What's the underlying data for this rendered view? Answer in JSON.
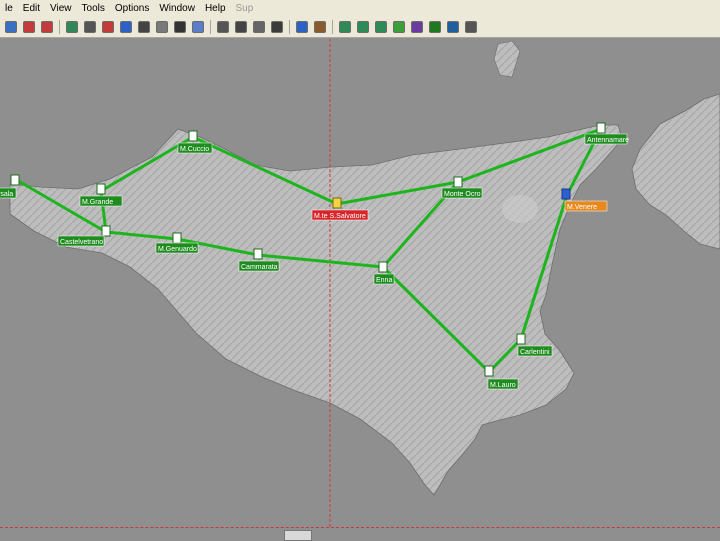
{
  "menu": {
    "items": [
      {
        "label": "le",
        "disabled": false
      },
      {
        "label": "Edit",
        "disabled": false
      },
      {
        "label": "View",
        "disabled": false
      },
      {
        "label": "Tools",
        "disabled": false
      },
      {
        "label": "Options",
        "disabled": false
      },
      {
        "label": "Window",
        "disabled": false
      },
      {
        "label": "Help",
        "disabled": false
      },
      {
        "label": "Sup",
        "disabled": true
      }
    ]
  },
  "toolbar": {
    "icons": [
      "save-icon",
      "close-doc-icon",
      "cut-icon",
      "globe-icon",
      "map-icon",
      "stop-icon",
      "chart-icon",
      "table-icon",
      "bars-icon",
      "signal-icon",
      "image-icon",
      "print-icon",
      "copy-icon",
      "paste-icon",
      "settings-icon",
      "window-icon",
      "user-icon",
      "vector-icon",
      "network-icon",
      "green-globe-icon",
      "leaf-icon",
      "pie-icon",
      "earth-icon",
      "monitor-icon",
      "trash-icon"
    ]
  },
  "map": {
    "colors": {
      "link": "#1db51d",
      "node_label_bg": "#1f8c1f",
      "selected_label_bg": "#d7262b",
      "highlight_label_bg": "#e8891d",
      "guide_line": "#d13a3a"
    },
    "nodes": [
      {
        "id": "marsala",
        "label": "rsala"
      },
      {
        "id": "mgrande",
        "label": "M.Grande"
      },
      {
        "id": "mcuccio",
        "label": "M.Cuccio"
      },
      {
        "id": "castelvetrano",
        "label": "Castelvetrano"
      },
      {
        "id": "mgenuardo",
        "label": "M.Genuardo"
      },
      {
        "id": "cammarata",
        "label": "Cammarata"
      },
      {
        "id": "msansalvatore",
        "label": "M.te S.Salvatore"
      },
      {
        "id": "enna",
        "label": "Enna"
      },
      {
        "id": "monteocro",
        "label": "Monte Ocro"
      },
      {
        "id": "antennamare",
        "label": "Antennamare"
      },
      {
        "id": "mvenere",
        "label": "M.Venere"
      },
      {
        "id": "carlentini",
        "label": "Carlentini"
      },
      {
        "id": "mlauro",
        "label": "M.Lauro"
      }
    ]
  }
}
